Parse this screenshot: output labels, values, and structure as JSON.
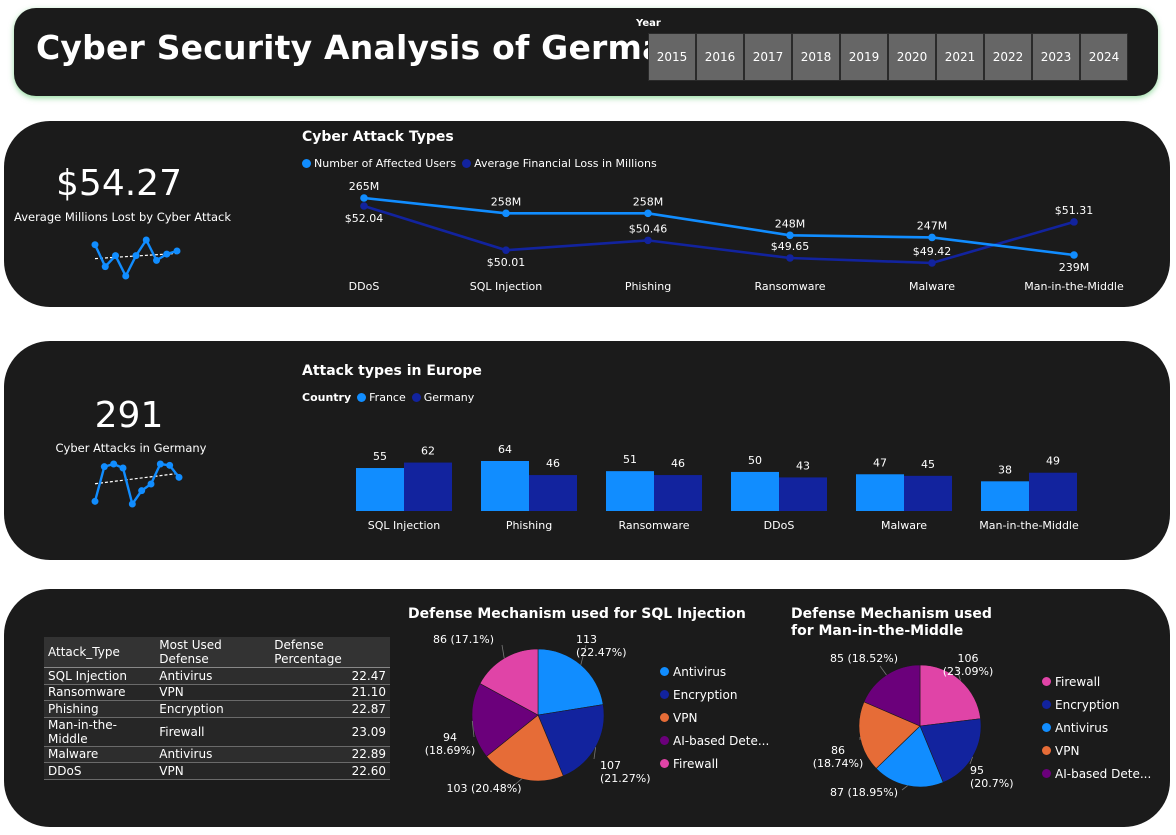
{
  "header": {
    "title": "Cyber Security Analysis of Germany",
    "year_label": "Year",
    "years": [
      "2015",
      "2016",
      "2017",
      "2018",
      "2019",
      "2020",
      "2021",
      "2022",
      "2023",
      "2024"
    ]
  },
  "kpi1": {
    "value": "$54.27",
    "label": "Average Millions Lost by Cyber Attack",
    "sparkline": [
      62,
      48,
      55,
      42,
      55,
      65,
      52,
      56,
      58
    ]
  },
  "kpi2": {
    "value": "291",
    "label": "Cyber Attacks in Germany",
    "sparkline": [
      22,
      48,
      50,
      47,
      20,
      30,
      35,
      50,
      49,
      40
    ]
  },
  "colors": {
    "light_blue": "#118DFF",
    "dark_blue": "#12239E",
    "orange": "#E66C37",
    "purple": "#6B007B",
    "pink": "#E044A7"
  },
  "chart_data": [
    {
      "type": "line",
      "title": "Cyber Attack Types",
      "categories": [
        "DDoS",
        "SQL Injection",
        "Phishing",
        "Ransomware",
        "Malware",
        "Man-in-the-Middle"
      ],
      "series": [
        {
          "name": "Number of Affected Users",
          "values": [
            265,
            258,
            258,
            248,
            247,
            239
          ],
          "labels": [
            "265M",
            "258M",
            "258M",
            "248M",
            "247M",
            "239M"
          ]
        },
        {
          "name": "Average Financial Loss in Millions",
          "values": [
            52.04,
            50.01,
            50.46,
            49.65,
            49.42,
            51.31
          ],
          "labels": [
            "$52.04",
            "$50.01",
            "$50.46",
            "$49.65",
            "$49.42",
            "$51.31"
          ]
        }
      ]
    },
    {
      "type": "bar",
      "title": "Attack types in Europe",
      "legend_title": "Country",
      "categories": [
        "SQL Injection",
        "Phishing",
        "Ransomware",
        "DDoS",
        "Malware",
        "Man-in-the-Middle"
      ],
      "series": [
        {
          "name": "France",
          "values": [
            55,
            64,
            51,
            50,
            47,
            38
          ]
        },
        {
          "name": "Germany",
          "values": [
            62,
            46,
            46,
            43,
            45,
            49
          ]
        }
      ]
    },
    {
      "type": "table",
      "columns": [
        "Attack_Type",
        "Most Used Defense",
        "Defense Percentage"
      ],
      "rows": [
        [
          "SQL Injection",
          "Antivirus",
          "22.47"
        ],
        [
          "Ransomware",
          "VPN",
          "21.10"
        ],
        [
          "Phishing",
          "Encryption",
          "22.87"
        ],
        [
          "Man-in-the-Middle",
          "Firewall",
          "23.09"
        ],
        [
          "Malware",
          "Antivirus",
          "22.89"
        ],
        [
          "DDoS",
          "VPN",
          "22.60"
        ]
      ]
    },
    {
      "type": "pie",
      "title": "Defense Mechanism used for SQL Injection",
      "legend": [
        "Antivirus",
        "Encryption",
        "VPN",
        "AI-based Dete...",
        "Firewall"
      ],
      "slices": [
        {
          "name": "Antivirus",
          "value": 113,
          "label": "113\n(22.47%)"
        },
        {
          "name": "Encryption",
          "value": 107,
          "label": "107\n(21.27%)"
        },
        {
          "name": "VPN",
          "value": 103,
          "label": "103 (20.48%)"
        },
        {
          "name": "AI-based Detection",
          "value": 94,
          "label": "94\n(18.69%)"
        },
        {
          "name": "Firewall",
          "value": 86,
          "label": "86 (17.1%)"
        }
      ]
    },
    {
      "type": "pie",
      "title": "Defense Mechanism used for Man-in-the-Middle",
      "legend": [
        "Firewall",
        "Encryption",
        "Antivirus",
        "VPN",
        "AI-based Dete..."
      ],
      "slices": [
        {
          "name": "Firewall",
          "value": 106,
          "label": "106\n(23.09%)"
        },
        {
          "name": "Encryption",
          "value": 95,
          "label": "95\n(20.7%)"
        },
        {
          "name": "Antivirus",
          "value": 87,
          "label": "87 (18.95%)"
        },
        {
          "name": "VPN",
          "value": 86,
          "label": "86\n(18.74%)"
        },
        {
          "name": "AI-based Detection",
          "value": 85,
          "label": "85 (18.52%)"
        }
      ]
    }
  ]
}
